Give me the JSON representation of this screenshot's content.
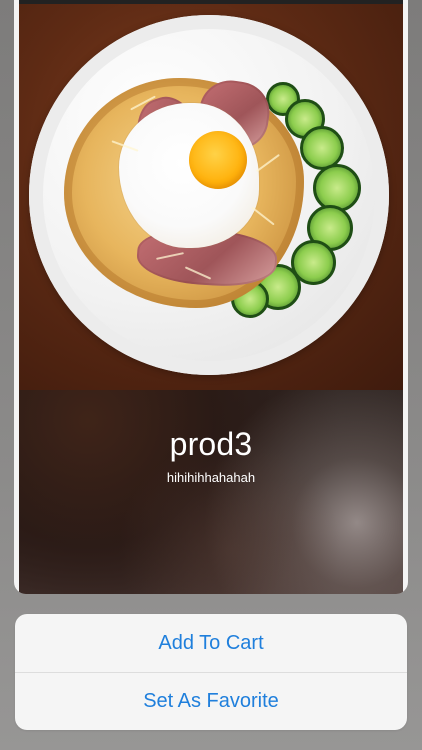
{
  "product": {
    "title": "prod3",
    "subtitle": "hihihihhahahah"
  },
  "actions": [
    {
      "label": "Add To Cart"
    },
    {
      "label": "Set As Favorite"
    }
  ],
  "colors": {
    "accent": "#1F7FDC",
    "sheet_background": "#F5F5F5",
    "backdrop": "#8E8D8C"
  }
}
